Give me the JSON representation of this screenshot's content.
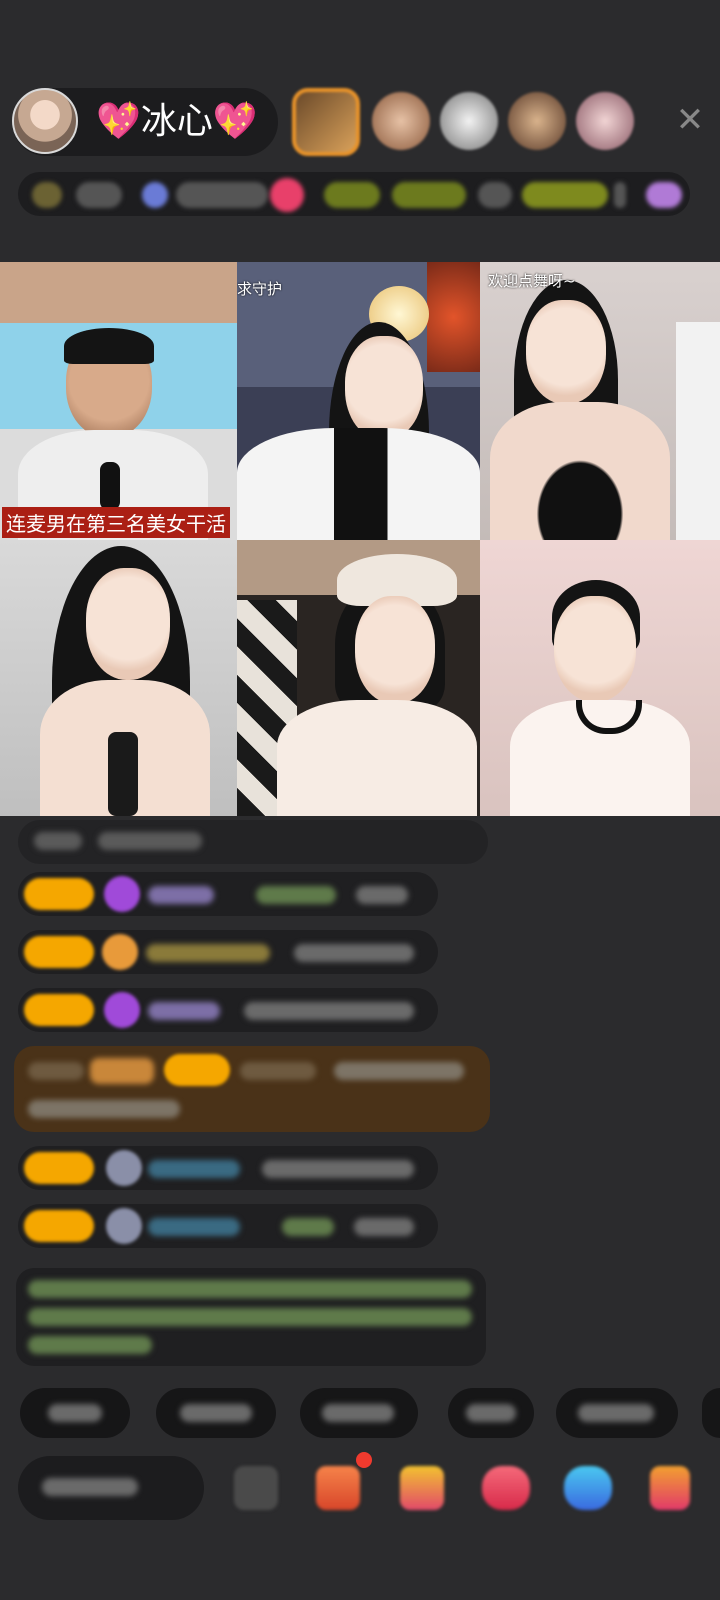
{
  "header": {
    "host_name": "💖冰心💖",
    "close_icon": "close-icon"
  },
  "video_grid": {
    "tiles": [
      {
        "caption": "连麦男在第三名美女干活"
      },
      {
        "tag": "求守护"
      },
      {
        "tag": "欢迎点舞呀~"
      },
      {},
      {},
      {}
    ]
  },
  "colors": {
    "background": "#2b2b2d",
    "pill": "#1c1c1e",
    "level_badge": "#f5a700",
    "caption_bg": "#ab1f14",
    "highlight_row": "#4a3218"
  }
}
